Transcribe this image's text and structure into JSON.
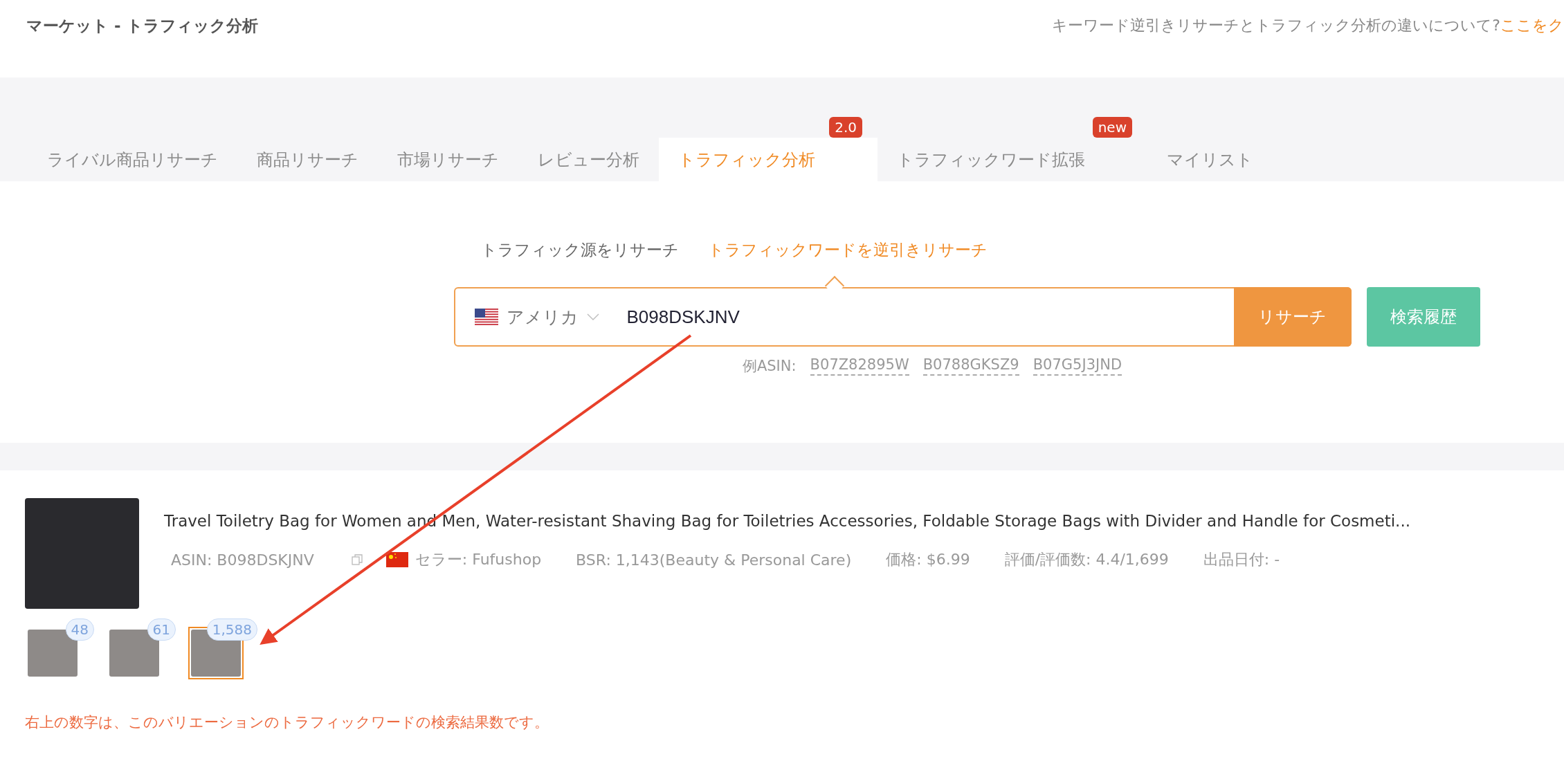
{
  "header": {
    "title": "マーケット - トラフィック分析",
    "help_text": "キーワード逆引きリサーチとトラフィック分析の違いについて?",
    "help_link": "ここをク"
  },
  "tabs": [
    {
      "label": "ライバル商品リサーチ",
      "selected": false
    },
    {
      "label": "商品リサーチ",
      "selected": false
    },
    {
      "label": "市場リサーチ",
      "selected": false
    },
    {
      "label": "レビュー分析",
      "selected": false
    },
    {
      "label": "トラフィック分析",
      "selected": true,
      "badge": "2.0"
    },
    {
      "label": "トラフィックワード拡張",
      "selected": false,
      "badge": "new"
    },
    {
      "label": "マイリスト",
      "selected": false
    }
  ],
  "subtabs": [
    {
      "label": "トラフィック源をリサーチ",
      "selected": false
    },
    {
      "label": "トラフィックワードを逆引きリサーチ",
      "selected": true
    }
  ],
  "search": {
    "country": "アメリカ",
    "value": "B098DSKJNV",
    "button": "リサーチ",
    "history_button": "検索履歴",
    "examples_label": "例ASIN:",
    "examples": [
      "B07Z82895W",
      "B0788GKSZ9",
      "B07G5J3JND"
    ]
  },
  "product": {
    "title": "Travel Toiletry Bag for Women and Men, Water-resistant Shaving Bag for Toiletries Accessories, Foldable Storage Bags with Divider and Handle for Cosmeti...",
    "asin": "ASIN: B098DSKJNV",
    "seller": "セラー: Fufushop",
    "bsr": "BSR: 1,143(Beauty & Personal Care)",
    "price": "価格: $6.99",
    "rating": "評価/評価数: 4.4/1,699",
    "date": "出品日付: -",
    "variations": [
      {
        "count": "48",
        "selected": false
      },
      {
        "count": "61",
        "selected": false
      },
      {
        "count": "1,588",
        "selected": true
      }
    ],
    "note": "右上の数字は、このバリエーションのトラフィックワードの検索結果数です。"
  }
}
